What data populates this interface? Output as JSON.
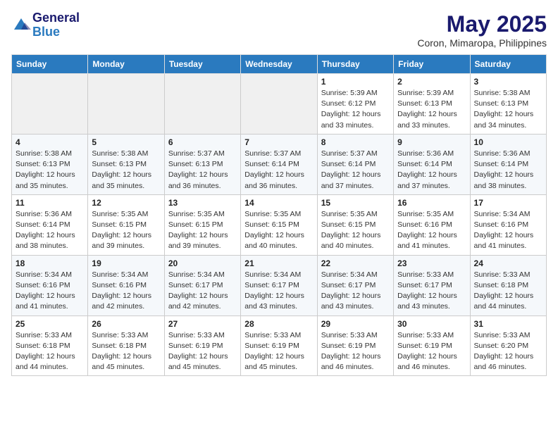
{
  "header": {
    "logo_line1": "General",
    "logo_line2": "Blue",
    "month_title": "May 2025",
    "subtitle": "Coron, Mimaropa, Philippines"
  },
  "weekdays": [
    "Sunday",
    "Monday",
    "Tuesday",
    "Wednesday",
    "Thursday",
    "Friday",
    "Saturday"
  ],
  "weeks": [
    [
      {
        "day": "",
        "empty": true
      },
      {
        "day": "",
        "empty": true
      },
      {
        "day": "",
        "empty": true
      },
      {
        "day": "",
        "empty": true
      },
      {
        "day": "1",
        "sunrise": "5:39 AM",
        "sunset": "6:12 PM",
        "daylight": "12 hours and 33 minutes."
      },
      {
        "day": "2",
        "sunrise": "5:39 AM",
        "sunset": "6:13 PM",
        "daylight": "12 hours and 33 minutes."
      },
      {
        "day": "3",
        "sunrise": "5:38 AM",
        "sunset": "6:13 PM",
        "daylight": "12 hours and 34 minutes."
      }
    ],
    [
      {
        "day": "4",
        "sunrise": "5:38 AM",
        "sunset": "6:13 PM",
        "daylight": "12 hours and 35 minutes."
      },
      {
        "day": "5",
        "sunrise": "5:38 AM",
        "sunset": "6:13 PM",
        "daylight": "12 hours and 35 minutes."
      },
      {
        "day": "6",
        "sunrise": "5:37 AM",
        "sunset": "6:13 PM",
        "daylight": "12 hours and 36 minutes."
      },
      {
        "day": "7",
        "sunrise": "5:37 AM",
        "sunset": "6:14 PM",
        "daylight": "12 hours and 36 minutes."
      },
      {
        "day": "8",
        "sunrise": "5:37 AM",
        "sunset": "6:14 PM",
        "daylight": "12 hours and 37 minutes."
      },
      {
        "day": "9",
        "sunrise": "5:36 AM",
        "sunset": "6:14 PM",
        "daylight": "12 hours and 37 minutes."
      },
      {
        "day": "10",
        "sunrise": "5:36 AM",
        "sunset": "6:14 PM",
        "daylight": "12 hours and 38 minutes."
      }
    ],
    [
      {
        "day": "11",
        "sunrise": "5:36 AM",
        "sunset": "6:14 PM",
        "daylight": "12 hours and 38 minutes."
      },
      {
        "day": "12",
        "sunrise": "5:35 AM",
        "sunset": "6:15 PM",
        "daylight": "12 hours and 39 minutes."
      },
      {
        "day": "13",
        "sunrise": "5:35 AM",
        "sunset": "6:15 PM",
        "daylight": "12 hours and 39 minutes."
      },
      {
        "day": "14",
        "sunrise": "5:35 AM",
        "sunset": "6:15 PM",
        "daylight": "12 hours and 40 minutes."
      },
      {
        "day": "15",
        "sunrise": "5:35 AM",
        "sunset": "6:15 PM",
        "daylight": "12 hours and 40 minutes."
      },
      {
        "day": "16",
        "sunrise": "5:35 AM",
        "sunset": "6:16 PM",
        "daylight": "12 hours and 41 minutes."
      },
      {
        "day": "17",
        "sunrise": "5:34 AM",
        "sunset": "6:16 PM",
        "daylight": "12 hours and 41 minutes."
      }
    ],
    [
      {
        "day": "18",
        "sunrise": "5:34 AM",
        "sunset": "6:16 PM",
        "daylight": "12 hours and 41 minutes."
      },
      {
        "day": "19",
        "sunrise": "5:34 AM",
        "sunset": "6:16 PM",
        "daylight": "12 hours and 42 minutes."
      },
      {
        "day": "20",
        "sunrise": "5:34 AM",
        "sunset": "6:17 PM",
        "daylight": "12 hours and 42 minutes."
      },
      {
        "day": "21",
        "sunrise": "5:34 AM",
        "sunset": "6:17 PM",
        "daylight": "12 hours and 43 minutes."
      },
      {
        "day": "22",
        "sunrise": "5:34 AM",
        "sunset": "6:17 PM",
        "daylight": "12 hours and 43 minutes."
      },
      {
        "day": "23",
        "sunrise": "5:33 AM",
        "sunset": "6:17 PM",
        "daylight": "12 hours and 43 minutes."
      },
      {
        "day": "24",
        "sunrise": "5:33 AM",
        "sunset": "6:18 PM",
        "daylight": "12 hours and 44 minutes."
      }
    ],
    [
      {
        "day": "25",
        "sunrise": "5:33 AM",
        "sunset": "6:18 PM",
        "daylight": "12 hours and 44 minutes."
      },
      {
        "day": "26",
        "sunrise": "5:33 AM",
        "sunset": "6:18 PM",
        "daylight": "12 hours and 45 minutes."
      },
      {
        "day": "27",
        "sunrise": "5:33 AM",
        "sunset": "6:19 PM",
        "daylight": "12 hours and 45 minutes."
      },
      {
        "day": "28",
        "sunrise": "5:33 AM",
        "sunset": "6:19 PM",
        "daylight": "12 hours and 45 minutes."
      },
      {
        "day": "29",
        "sunrise": "5:33 AM",
        "sunset": "6:19 PM",
        "daylight": "12 hours and 46 minutes."
      },
      {
        "day": "30",
        "sunrise": "5:33 AM",
        "sunset": "6:19 PM",
        "daylight": "12 hours and 46 minutes."
      },
      {
        "day": "31",
        "sunrise": "5:33 AM",
        "sunset": "6:20 PM",
        "daylight": "12 hours and 46 minutes."
      }
    ]
  ]
}
